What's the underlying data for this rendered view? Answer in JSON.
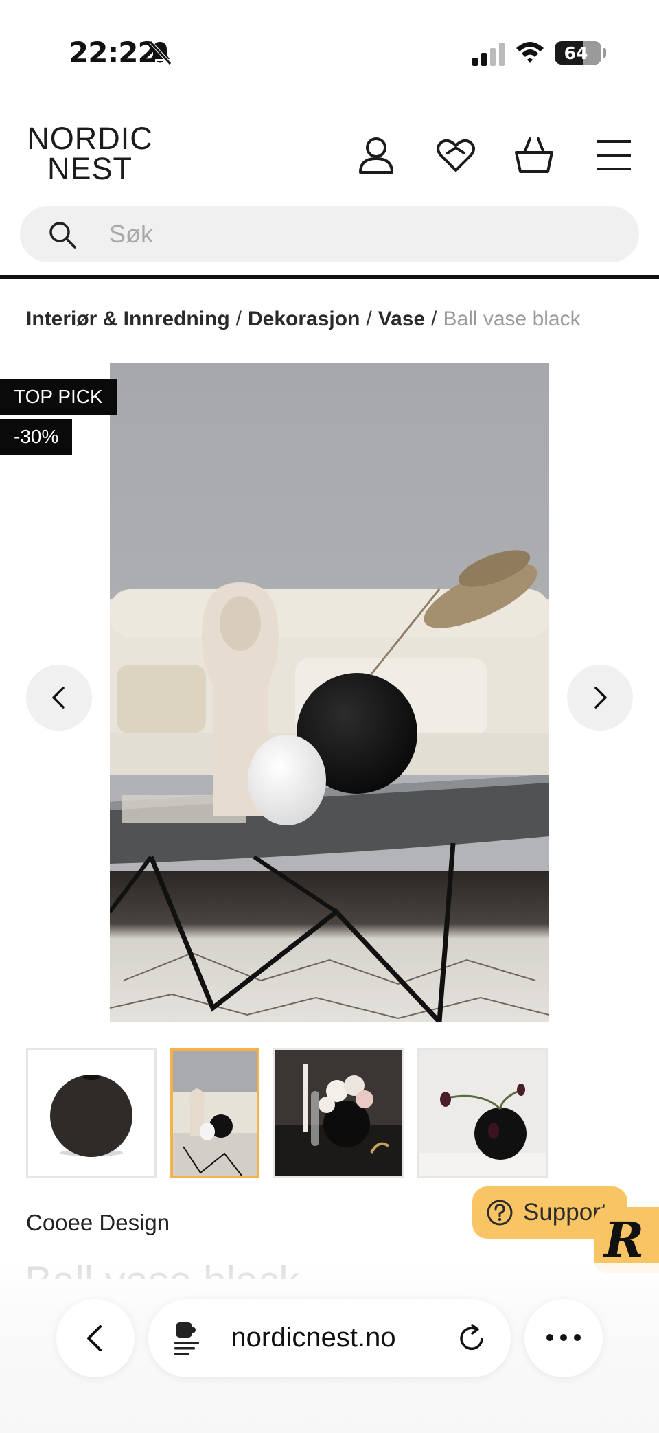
{
  "status_bar": {
    "time": "22:22",
    "battery": "64",
    "battery_level": 0.64,
    "icons": [
      "bell-slash-icon",
      "cellular-signal-icon",
      "wifi-icon",
      "battery-icon"
    ]
  },
  "header": {
    "logo_line1": "NORDIC",
    "logo_line2": "NEST",
    "icons": [
      "account-icon",
      "wishlist-heart-icon",
      "basket-icon",
      "menu-icon"
    ]
  },
  "search": {
    "placeholder": "Søk",
    "value": ""
  },
  "breadcrumb": {
    "items": [
      "Interiør & Innredning",
      "Dekorasjon",
      "Vase"
    ],
    "separator": "/",
    "current": "Ball vase black"
  },
  "badges": {
    "top_pick": "TOP PICK",
    "discount": "-30%"
  },
  "gallery": {
    "selected_index": 1,
    "thumbnail_count": 4
  },
  "product": {
    "brand": "Cooee Design",
    "title": "Ball vase black"
  },
  "support": {
    "label": "Support"
  },
  "r_widget": {
    "label": "R"
  },
  "browser_bar": {
    "url": "nordicnest.no"
  },
  "colors": {
    "accent_yellow": "#f9c463",
    "thumb_selected": "#f3b24a",
    "badge_black": "#0a0a0a"
  }
}
